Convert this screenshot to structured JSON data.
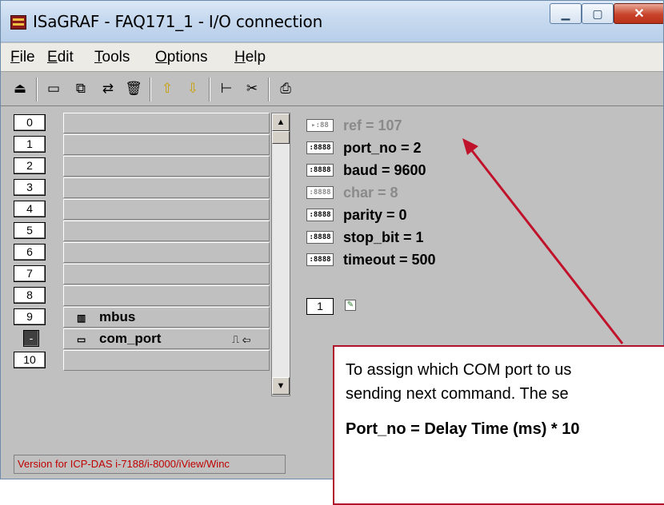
{
  "window": {
    "title": "ISaGRAF - FAQ171_1 - I/O connection",
    "controls": [
      "minimize",
      "maximize",
      "close"
    ]
  },
  "menubar": {
    "items": [
      {
        "label": "File",
        "accel": "F"
      },
      {
        "label": "Edit",
        "accel": "E"
      },
      {
        "label": "Tools",
        "accel": "T"
      },
      {
        "label": "Options",
        "accel": "O"
      },
      {
        "label": "Help",
        "accel": "H"
      }
    ]
  },
  "toolbar": {
    "icons": [
      "open-icon",
      "board-icon",
      "board-copy-icon",
      "board-connect-icon",
      "delete-icon",
      "move-up-icon",
      "move-down-icon",
      "tree-icon",
      "cut-icon",
      "print-icon"
    ]
  },
  "list": {
    "rows": [
      {
        "index": "0",
        "name": ""
      },
      {
        "index": "1",
        "name": ""
      },
      {
        "index": "2",
        "name": ""
      },
      {
        "index": "3",
        "name": ""
      },
      {
        "index": "4",
        "name": ""
      },
      {
        "index": "5",
        "name": ""
      },
      {
        "index": "6",
        "name": ""
      },
      {
        "index": "7",
        "name": ""
      },
      {
        "index": "8",
        "name": ""
      },
      {
        "index": "9",
        "name": "mbus"
      },
      {
        "index": "-",
        "name": "com_port"
      },
      {
        "index": "10",
        "name": ""
      }
    ]
  },
  "params": {
    "items": [
      {
        "text": "ref = 107",
        "enabled": false
      },
      {
        "text": "port_no = 2",
        "enabled": true
      },
      {
        "text": "baud = 9600",
        "enabled": true
      },
      {
        "text": "char = 8",
        "enabled": false
      },
      {
        "text": "parity = 0",
        "enabled": true
      },
      {
        "text": "stop_bit = 1",
        "enabled": true
      },
      {
        "text": "timeout = 500",
        "enabled": true
      }
    ],
    "count": "1"
  },
  "status": {
    "text": "Version for ICP-DAS i-7188/i-8000/iView/Winc"
  },
  "annotation": {
    "line1": "To assign which COM port to us",
    "line2": "sending next command. The se",
    "formula": "Port_no = Delay Time (ms) * 10",
    "color": "#c0132b"
  }
}
